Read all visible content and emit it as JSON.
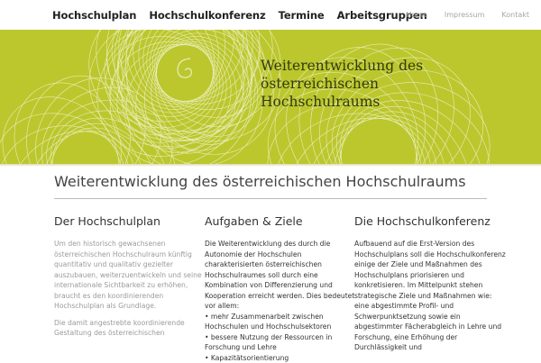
{
  "nav": {
    "main": [
      "Hochschulplan",
      "Hochschulkonferenz",
      "Termine",
      "Arbeitsgruppen"
    ],
    "meta": [
      "Home",
      "Impressum",
      "Kontakt"
    ]
  },
  "banner": {
    "title": "Weiterentwicklung des\nösterreichischen\nHochschulraums"
  },
  "page": {
    "heading": "Weiterentwicklung des österreichischen Hochschulraums"
  },
  "columns": [
    {
      "title": "Der Hochschulplan",
      "paragraphs": [
        "Um den historisch gewachsenen österreichischen Hochschulraum künftig quantitativ und qualitativ gezielter auszubauen, weiterzuentwickeln und seine internationale Sichtbarkeit zu erhöhen, braucht es den koordinierenden Hochschulplan als Grundlage.",
        "Die damit angestrebte koordinierende Gestaltung des österreichischen"
      ]
    },
    {
      "title": "Aufgaben & Ziele",
      "paragraphs": [
        "Die Weiterentwicklung des durch die Autonomie der Hochschulen charakterisierten österreichischen Hochschulraumes soll durch eine Kombination von Differenzierung und Kooperation erreicht werden. Dies bedeutet vor allem:"
      ],
      "bullets": [
        "• mehr Zusammenarbeit zwischen Hochschulen und Hochschulsektoren",
        "• bessere Nutzung der Ressourcen in Forschung und Lehre",
        "• Kapazitätsorientierung"
      ]
    },
    {
      "title": "Die Hochschulkonferenz",
      "paragraphs": [
        "Aufbauend auf die Erst-Version des Hochschulplans soll die Hochschulkonferenz einige der Ziele und Maßnahmen des Hochschulplans priorisieren und konkretisieren. Im Mittelpunkt stehen strategische Ziele und Maßnahmen wie: eine abgestimmte Profil- und Schwerpunktsetzung sowie ein abgestimmter Fächerabgleich in Lehre und Forschung, eine Erhöhung der Durchlässigkeit und"
      ]
    }
  ],
  "colors": {
    "banner": "#bcc72e",
    "banner_text": "#333a0e",
    "nav_text": "#222222",
    "meta_text": "#a6a6a6",
    "body_muted": "#9a9a9a"
  }
}
